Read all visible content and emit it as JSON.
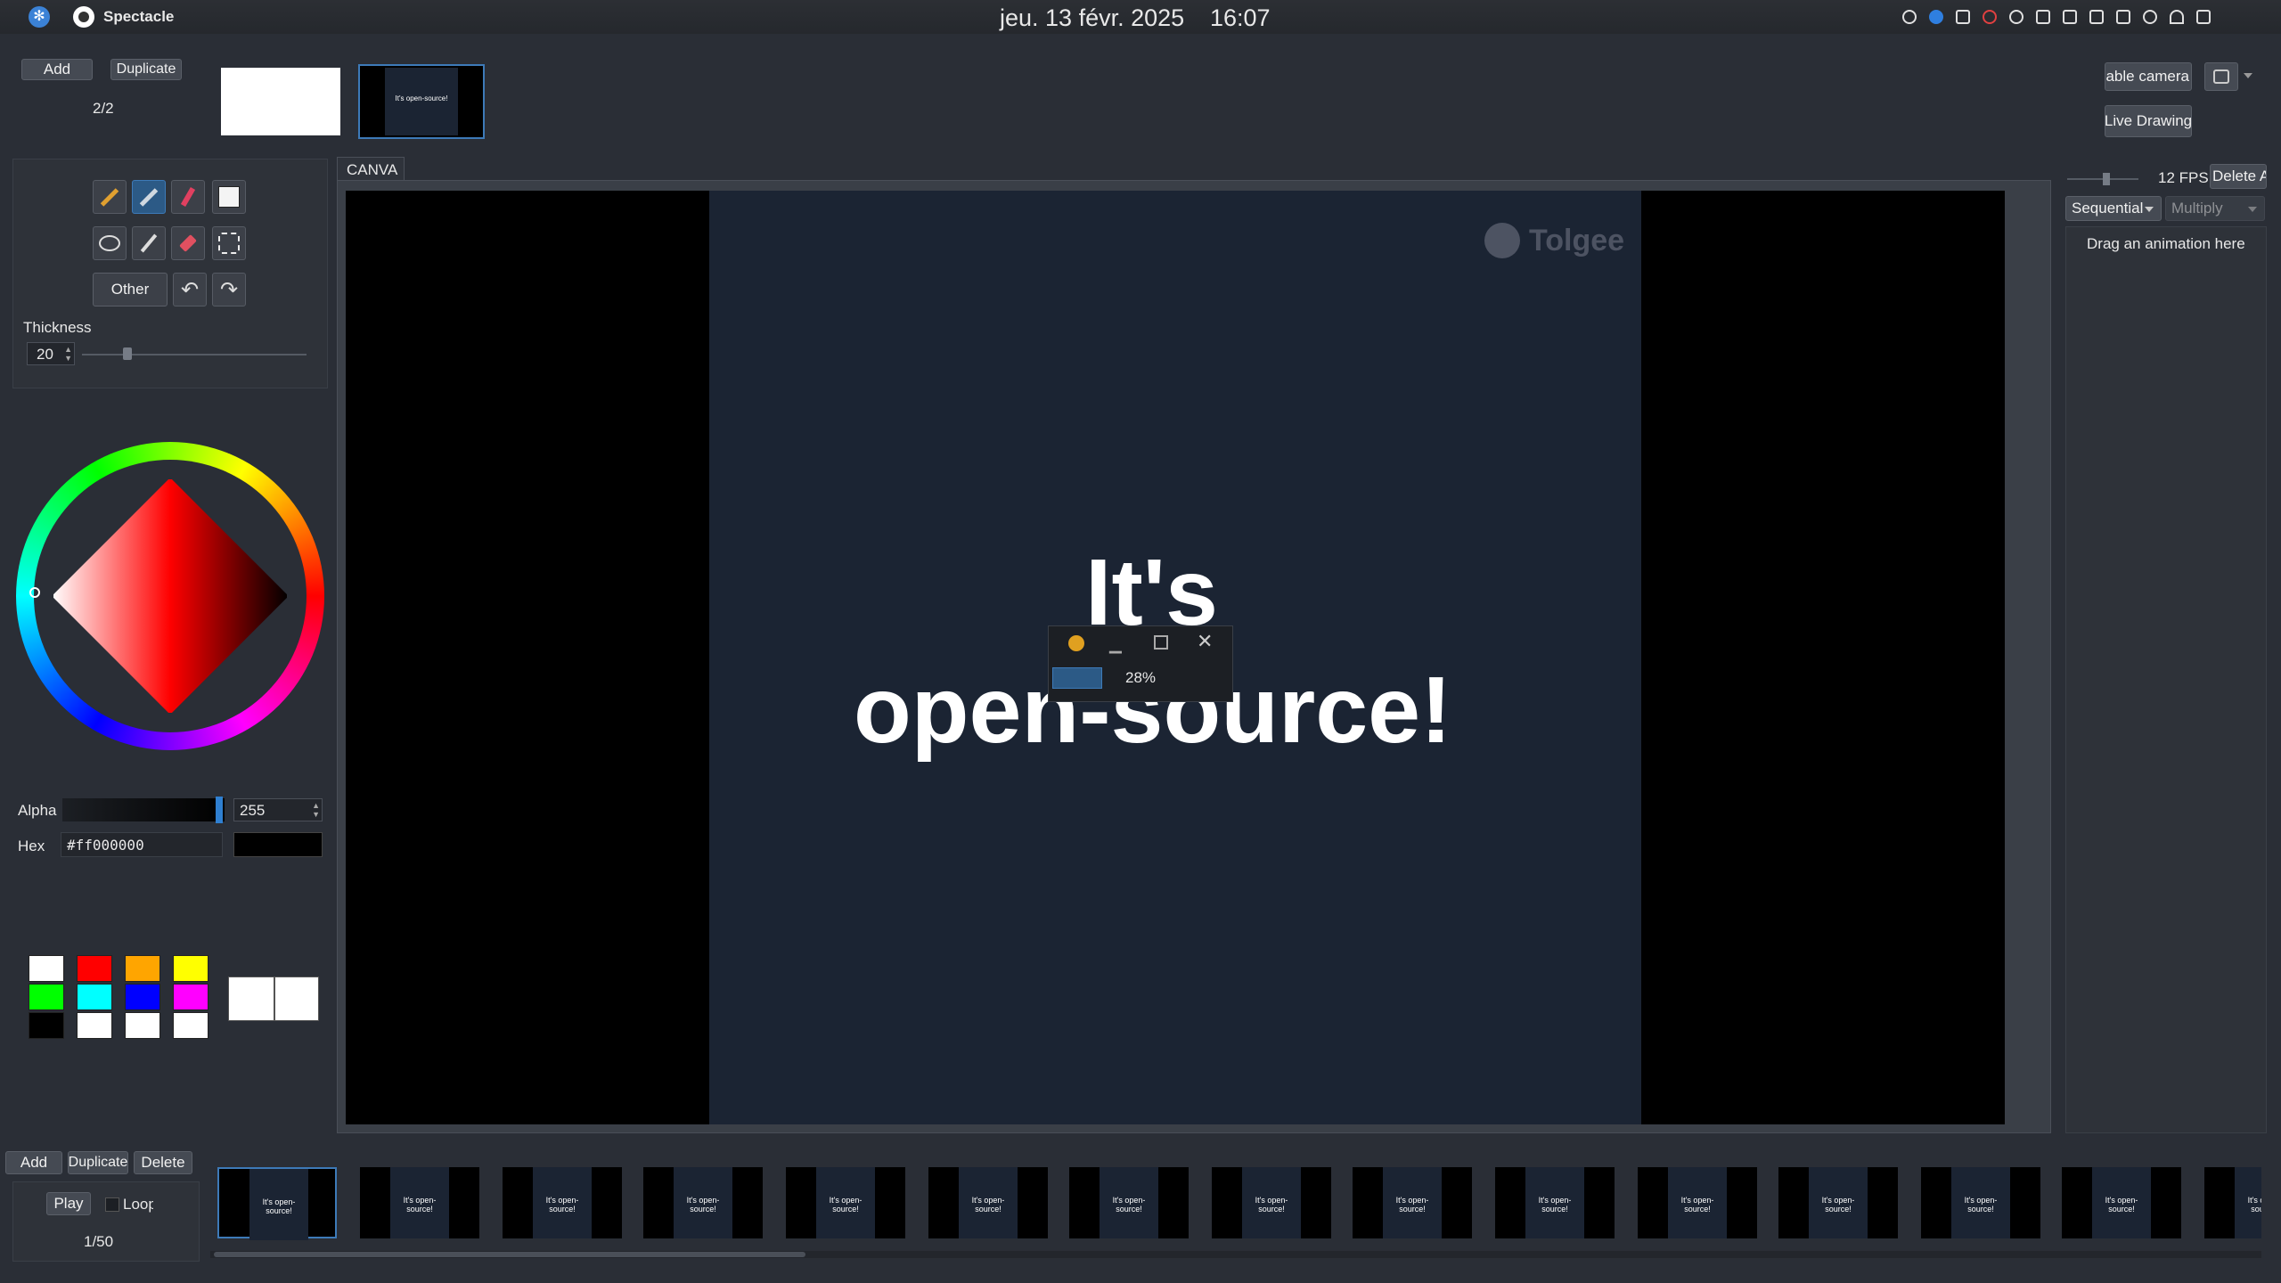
{
  "topbar": {
    "app_name": "Spectacle",
    "date": "jeu. 13 févr. 2025",
    "time": "16:07"
  },
  "slides": {
    "add": "Add",
    "duplicate": "Duplicate",
    "counter": "2/2",
    "thumb_text": "It's open-source!"
  },
  "camera": {
    "enable": "Enable camera",
    "live_drawing": "Live Drawing"
  },
  "tools": {
    "other": "Other",
    "thickness_label": "Thickness",
    "thickness_value": "20",
    "thickness_fraction": 0.2
  },
  "color": {
    "alpha_label": "Alpha",
    "alpha_value": "255",
    "hex_label": "Hex",
    "hex_value": "#ff000000",
    "swatches": [
      "#ffffff",
      "#ff0000",
      "#ffa500",
      "#ffff00",
      "#00ff00",
      "#00ffff",
      "#0000ff",
      "#ff00ff",
      "#000000",
      "#ffffff",
      "#ffffff",
      "#ffffff"
    ]
  },
  "canvas": {
    "tab": "CANVA",
    "line1": "It's",
    "line2": "open-source!",
    "watermark": "Tolgee"
  },
  "recording": {
    "percent": "28%"
  },
  "animation": {
    "fps": "12 FPS",
    "delete": "Delete All",
    "mode": "Sequential",
    "blend": "Multiply",
    "drop_hint": "Drag an animation here"
  },
  "timeline": {
    "add": "Add",
    "duplicate": "Duplicate",
    "delete": "Delete",
    "play": "Play",
    "loop": "Loop",
    "counter": "1/50",
    "frame_text": "It's open-source!"
  }
}
